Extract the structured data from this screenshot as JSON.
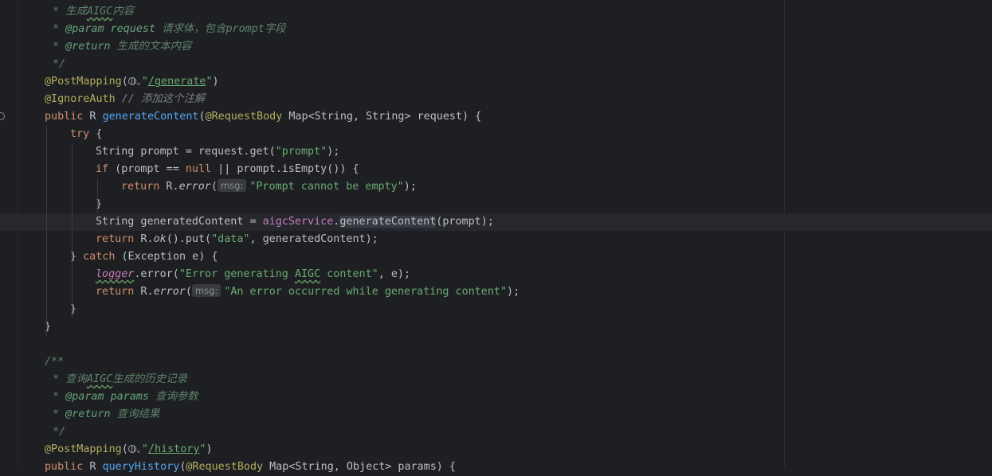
{
  "editor": {
    "lines": [
      {
        "id": "l1",
        "parts": [
          {
            "c": "cmt",
            "t": " * 生成"
          },
          {
            "c": "cmt wavy",
            "t": "AIGC"
          },
          {
            "c": "cmt",
            "t": "内容"
          }
        ]
      },
      {
        "id": "l2",
        "parts": [
          {
            "c": "cmt",
            "t": " * "
          },
          {
            "c": "cmtag",
            "t": "@param"
          },
          {
            "c": "cmtag",
            "t": " request"
          },
          {
            "c": "cmt",
            "t": " 请求体，包含prompt字段"
          }
        ]
      },
      {
        "id": "l3",
        "parts": [
          {
            "c": "cmt",
            "t": " * "
          },
          {
            "c": "cmtag",
            "t": "@return"
          },
          {
            "c": "cmt",
            "t": " 生成的文本内容"
          }
        ]
      },
      {
        "id": "l4",
        "parts": [
          {
            "c": "cmt",
            "t": " */"
          }
        ]
      },
      {
        "id": "l5",
        "parts": [
          {
            "c": "ann",
            "t": "@PostMapping"
          },
          {
            "c": "",
            "t": "("
          },
          {
            "c": "globe",
            "t": ""
          },
          {
            "c": "chev",
            "t": "⌄"
          },
          {
            "c": "str",
            "t": "\""
          },
          {
            "c": "str ul",
            "t": "/generate"
          },
          {
            "c": "str",
            "t": "\""
          },
          {
            "c": "",
            "t": ")"
          }
        ]
      },
      {
        "id": "l6",
        "parts": [
          {
            "c": "ann",
            "t": "@IgnoreAuth"
          },
          {
            "c": "",
            "t": " "
          },
          {
            "c": "cm",
            "t": "// "
          },
          {
            "c": "cm",
            "t": "添加这个注解"
          }
        ]
      },
      {
        "id": "l7",
        "parts": [
          {
            "c": "kw",
            "t": "public"
          },
          {
            "c": "",
            "t": " R "
          },
          {
            "c": "fn",
            "t": "generateContent"
          },
          {
            "c": "",
            "t": "("
          },
          {
            "c": "ann",
            "t": "@RequestBody"
          },
          {
            "c": "",
            "t": " Map<String, String> request) {"
          }
        ]
      },
      {
        "id": "l8",
        "parts": [
          {
            "c": "kw",
            "t": "try"
          },
          {
            "c": "",
            "t": " {"
          }
        ]
      },
      {
        "id": "l9",
        "parts": [
          {
            "c": "",
            "t": "String prompt = request.get("
          },
          {
            "c": "str",
            "t": "\"prompt\""
          },
          {
            "c": "",
            "t": ");"
          }
        ]
      },
      {
        "id": "l10",
        "parts": [
          {
            "c": "kw",
            "t": "if"
          },
          {
            "c": "",
            "t": " (prompt == "
          },
          {
            "c": "kw",
            "t": "null"
          },
          {
            "c": "",
            "t": " || prompt.isEmpty()) {"
          }
        ]
      },
      {
        "id": "l11",
        "parts": [
          {
            "c": "kw",
            "t": "return"
          },
          {
            "c": "",
            "t": " R."
          },
          {
            "c": "ital",
            "t": "error"
          },
          {
            "c": "",
            "t": "("
          },
          {
            "c": "hint",
            "t": "msg:"
          },
          {
            "c": "str",
            "t": "\"Prompt cannot be empty\""
          },
          {
            "c": "",
            "t": ");"
          }
        ]
      },
      {
        "id": "l12",
        "parts": [
          {
            "c": "",
            "t": "}"
          }
        ]
      },
      {
        "id": "l13",
        "parts": [
          {
            "c": "",
            "t": "String generatedContent = "
          },
          {
            "c": "fld",
            "t": "aigcService"
          },
          {
            "c": "",
            "t": "."
          },
          {
            "c": "hl",
            "t": "generateContent"
          },
          {
            "c": "",
            "t": "(prompt);"
          }
        ]
      },
      {
        "id": "l14",
        "parts": [
          {
            "c": "kw",
            "t": "return"
          },
          {
            "c": "",
            "t": " R."
          },
          {
            "c": "ital",
            "t": "ok"
          },
          {
            "c": "",
            "t": "().put("
          },
          {
            "c": "str",
            "t": "\"data\""
          },
          {
            "c": "",
            "t": ", generatedContent);"
          }
        ]
      },
      {
        "id": "l15",
        "parts": [
          {
            "c": "",
            "t": "} "
          },
          {
            "c": "kw",
            "t": "catch"
          },
          {
            "c": "",
            "t": " (Exception e) {"
          }
        ]
      },
      {
        "id": "l16",
        "parts": [
          {
            "c": "fld ital wavy",
            "t": "logger"
          },
          {
            "c": "",
            "t": ".error("
          },
          {
            "c": "str",
            "t": "\"Error generating "
          },
          {
            "c": "str wavy",
            "t": "AIGC"
          },
          {
            "c": "str",
            "t": " content\""
          },
          {
            "c": "",
            "t": ", e);"
          }
        ]
      },
      {
        "id": "l17",
        "parts": [
          {
            "c": "kw",
            "t": "return"
          },
          {
            "c": "",
            "t": " R."
          },
          {
            "c": "ital",
            "t": "error"
          },
          {
            "c": "",
            "t": "("
          },
          {
            "c": "hint",
            "t": "msg:"
          },
          {
            "c": "str",
            "t": "\"An error occurred while generating content\""
          },
          {
            "c": "",
            "t": ");"
          }
        ]
      },
      {
        "id": "l18",
        "parts": [
          {
            "c": "",
            "t": "}"
          }
        ]
      },
      {
        "id": "l19",
        "parts": [
          {
            "c": "",
            "t": "}"
          }
        ]
      },
      {
        "id": "l20",
        "parts": []
      },
      {
        "id": "l21",
        "parts": [
          {
            "c": "cmt",
            "t": "/**"
          }
        ]
      },
      {
        "id": "l22",
        "parts": [
          {
            "c": "cmt",
            "t": " * 查询"
          },
          {
            "c": "cmt wavy",
            "t": "AIGC"
          },
          {
            "c": "cmt",
            "t": "生成的历史记录"
          }
        ]
      },
      {
        "id": "l23",
        "parts": [
          {
            "c": "cmt",
            "t": " * "
          },
          {
            "c": "cmtag",
            "t": "@param"
          },
          {
            "c": "cmtag",
            "t": " params"
          },
          {
            "c": "cmt",
            "t": " 查询参数"
          }
        ]
      },
      {
        "id": "l24",
        "parts": [
          {
            "c": "cmt",
            "t": " * "
          },
          {
            "c": "cmtag",
            "t": "@return"
          },
          {
            "c": "cmt",
            "t": " 查询结果"
          }
        ]
      },
      {
        "id": "l25",
        "parts": [
          {
            "c": "cmt",
            "t": " */"
          }
        ]
      },
      {
        "id": "l26",
        "parts": [
          {
            "c": "ann",
            "t": "@PostMapping"
          },
          {
            "c": "",
            "t": "("
          },
          {
            "c": "globe",
            "t": ""
          },
          {
            "c": "chev",
            "t": "⌄"
          },
          {
            "c": "str",
            "t": "\""
          },
          {
            "c": "str ul",
            "t": "/history"
          },
          {
            "c": "str",
            "t": "\""
          },
          {
            "c": "",
            "t": ")"
          }
        ]
      },
      {
        "id": "l27",
        "parts": [
          {
            "c": "kw",
            "t": "public"
          },
          {
            "c": "",
            "t": " R "
          },
          {
            "c": "fn",
            "t": "queryHistory"
          },
          {
            "c": "",
            "t": "("
          },
          {
            "c": "ann",
            "t": "@RequestBody"
          },
          {
            "c": "",
            "t": " Map<String, Object> params) {"
          }
        ]
      }
    ]
  }
}
